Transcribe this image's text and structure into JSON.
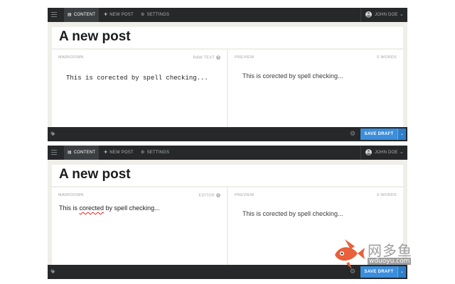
{
  "panels": [
    {
      "nav": {
        "content": "CONTENT",
        "new_post": "NEW POST",
        "settings": "SETTINGS"
      },
      "user": {
        "name": "JOHN DOE"
      },
      "title": "A new post",
      "editor": {
        "label": "MARKDOWN",
        "mode": "RAW TEXT",
        "text": "This is corected by spell checking..."
      },
      "preview": {
        "label": "PREVIEW",
        "word_count": "6 WORDS",
        "text": "This is corected by spell checking..."
      },
      "footer": {
        "save_label": "SAVE DRAFT"
      }
    },
    {
      "nav": {
        "content": "CONTENT",
        "new_post": "NEW POST",
        "settings": "SETTINGS"
      },
      "user": {
        "name": "JOHN DOE"
      },
      "title": "A new post",
      "editor": {
        "label": "MARKDOWN",
        "mode": "EDITOR",
        "text_before": "This is ",
        "text_misspelled": "corected",
        "text_after": " by spell checking..."
      },
      "preview": {
        "label": "PREVIEW",
        "word_count": "6 WORDS",
        "text": "This is corected by spell checking..."
      },
      "footer": {
        "save_label": "SAVE DRAFT"
      }
    }
  ],
  "watermark": {
    "cn": "网多鱼",
    "en": "wduoyu.com"
  },
  "colors": {
    "topbar": "#26282a",
    "accent": "#3b8edb",
    "panel_bg": "#efeee9",
    "fish": "#e8603c"
  }
}
